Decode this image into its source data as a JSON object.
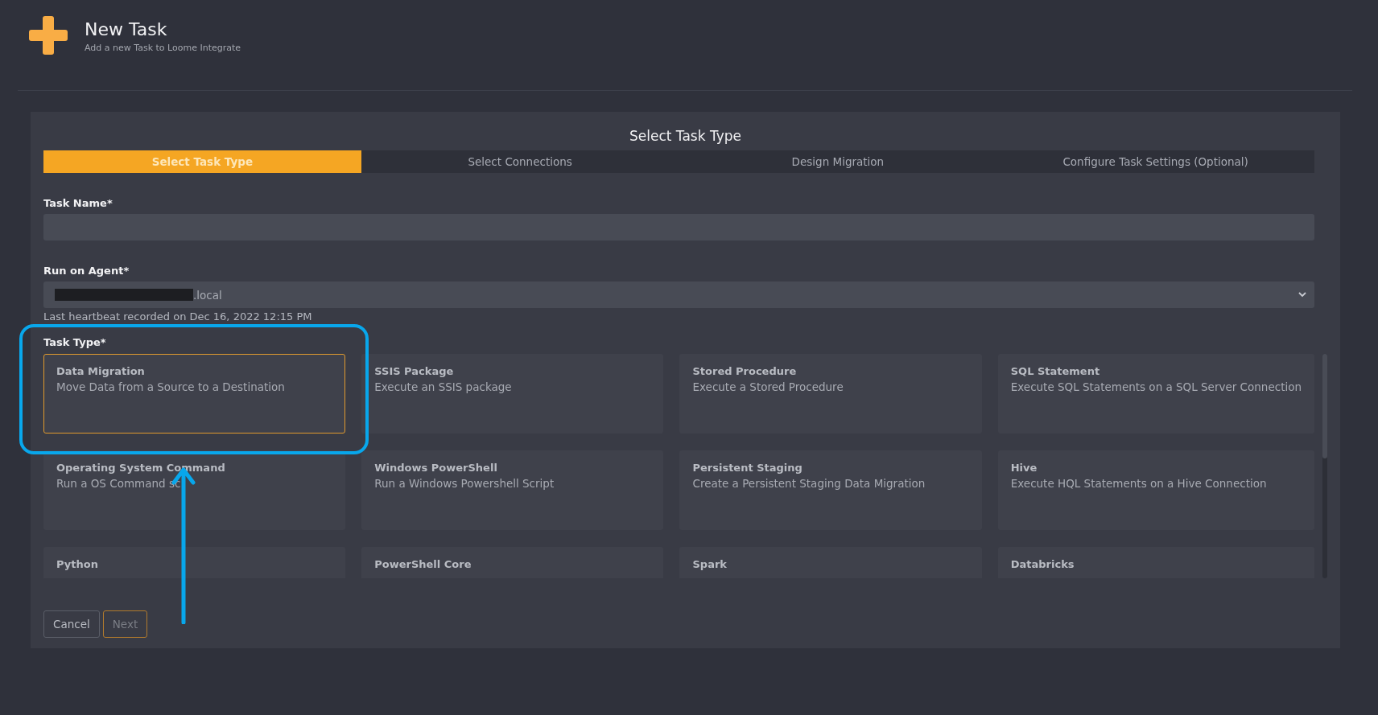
{
  "header": {
    "title": "New Task",
    "subtitle": "Add a new Task to Loome Integrate"
  },
  "panel_title": "Select Task Type",
  "steps": [
    {
      "label": "Select Task Type",
      "selected": true
    },
    {
      "label": "Select Connections",
      "selected": false
    },
    {
      "label": "Design Migration",
      "selected": false
    },
    {
      "label": "Configure Task Settings (Optional)",
      "selected": false
    }
  ],
  "task_name": {
    "label": "Task Name*"
  },
  "agent": {
    "label": "Run on Agent*",
    "value": ".local",
    "heartbeat": "Last heartbeat recorded on Dec 16, 2022 12:15 PM"
  },
  "task_type": {
    "label": "Task Type*",
    "cards": [
      {
        "title": "Data Migration",
        "description": "Move Data from a Source to a Destination",
        "selected": true
      },
      {
        "title": "SSIS Package",
        "description": "Execute an SSIS package",
        "selected": false
      },
      {
        "title": "Stored Procedure",
        "description": "Execute a Stored Procedure",
        "selected": false
      },
      {
        "title": "SQL Statement",
        "description": "Execute SQL Statements on a SQL Server Connection",
        "selected": false
      },
      {
        "title": "Operating System Command",
        "description": "Run a OS Command sc",
        "selected": false
      },
      {
        "title": "Windows PowerShell",
        "description": "Run a Windows Powershell Script",
        "selected": false
      },
      {
        "title": "Persistent Staging",
        "description": "Create a Persistent Staging Data Migration",
        "selected": false
      },
      {
        "title": "Hive",
        "description": "Execute HQL Statements on a Hive Connection",
        "selected": false
      },
      {
        "title": "Python",
        "selected": false
      },
      {
        "title": "PowerShell Core",
        "selected": false
      },
      {
        "title": "Spark",
        "selected": false
      },
      {
        "title": "Databricks",
        "selected": false
      }
    ]
  },
  "buttons": [
    {
      "label": "Cancel",
      "disabled": false
    },
    {
      "label": "Next",
      "disabled": true
    }
  ]
}
